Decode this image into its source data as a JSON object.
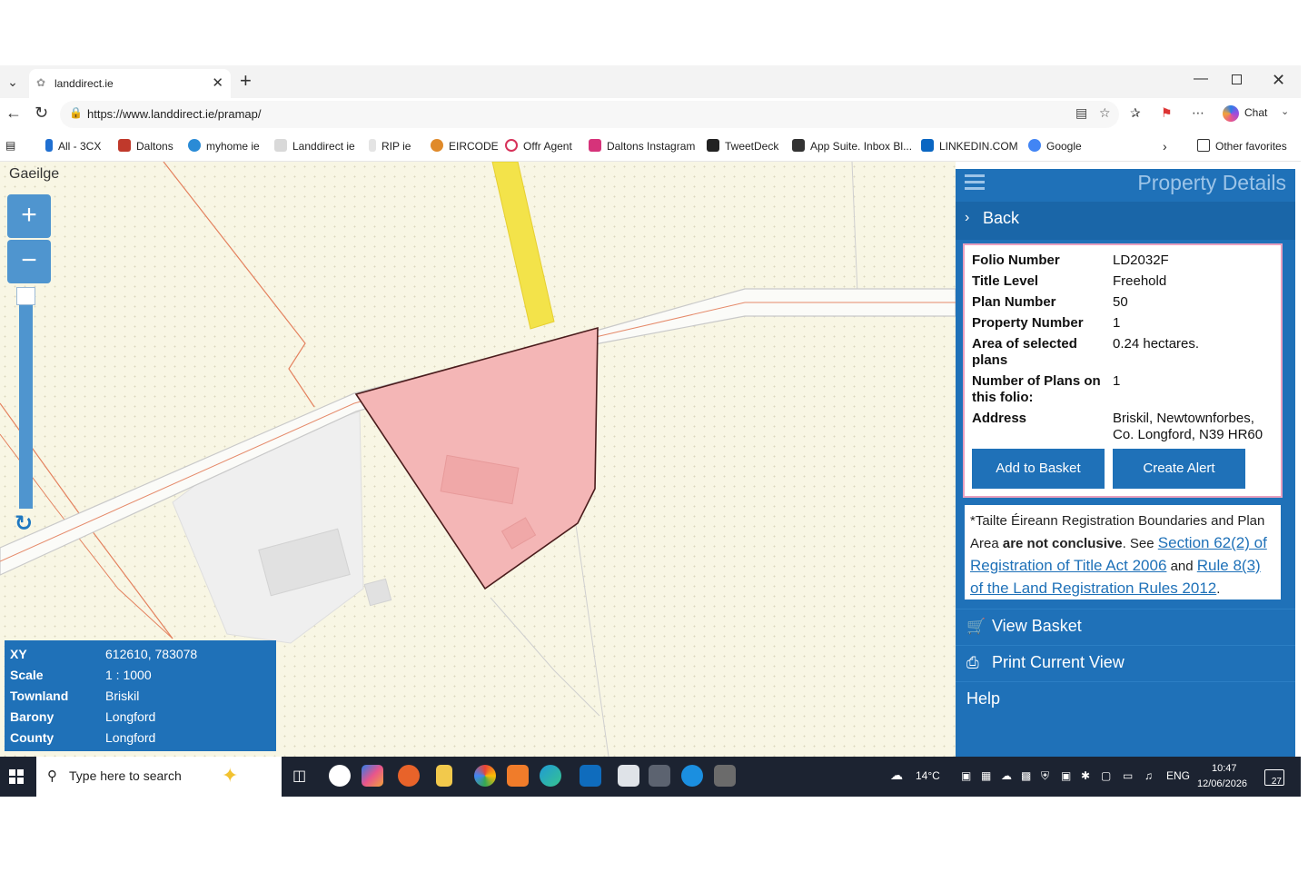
{
  "browser": {
    "tab_title": "landdirect.ie",
    "url": "https://www.landdirect.ie/pramap/",
    "chat_label": "Chat",
    "favorites": [
      {
        "label": "All - 3CX",
        "color": "#1f6fd1"
      },
      {
        "label": "Daltons",
        "color": "#c0392b"
      },
      {
        "label": "myhome ie",
        "color": "#2a8bd6"
      },
      {
        "label": "Landdirect ie",
        "color": "#b0b0b0"
      },
      {
        "label": "RIP ie",
        "color": "#c9c9c9"
      },
      {
        "label": "EIRCODE",
        "color": "#e08a2a"
      },
      {
        "label": "Offr Agent",
        "color": "#d7325a"
      },
      {
        "label": "Daltons Instagram",
        "color": "#d6337a"
      },
      {
        "label": "TweetDeck",
        "color": "#222222"
      },
      {
        "label": "App Suite. Inbox Bl...",
        "color": "#333333"
      },
      {
        "label": "LINKEDIN.COM",
        "color": "#0a66c2"
      },
      {
        "label": "Google",
        "color": "#4285f4"
      }
    ],
    "other_favorites": "Other favorites"
  },
  "map": {
    "language_toggle": "Gaeilge",
    "zoom_in": "+",
    "zoom_out": "−",
    "parcel_color": "#f4b6b6",
    "road_color": "#f3e34a",
    "info": [
      {
        "key": "XY",
        "value": "612610, 783078"
      },
      {
        "key": "Scale",
        "value": "1 : 1000"
      },
      {
        "key": "Townland",
        "value": "Briskil"
      },
      {
        "key": "Barony",
        "value": "Longford"
      },
      {
        "key": "County",
        "value": "Longford"
      }
    ]
  },
  "panel": {
    "title": "Property Details",
    "back": "Back",
    "details": [
      {
        "key": "Folio Number",
        "value": "LD2032F"
      },
      {
        "key": "Title Level",
        "value": "Freehold"
      },
      {
        "key": "Plan Number",
        "value": "50"
      },
      {
        "key": "Property Number",
        "value": "1"
      },
      {
        "key": "Area of selected plans",
        "value": "0.24 hectares."
      },
      {
        "key": "Number of Plans on this folio:",
        "value": "1"
      },
      {
        "key": "Address",
        "value": "Briskil, Newtownforbes, Co. Longford, N39 HR60"
      }
    ],
    "add_to_basket": "Add to Basket",
    "create_alert": "Create Alert",
    "notice": {
      "prefix": "*Tailte Éireann Registration Boundaries and Plan Area",
      "bold": "are not conclusive",
      "see": ". See",
      "link1": "Section 62(2) of Registration of Title Act 2006",
      "and": "and",
      "link2": "Rule 8(3) of the Land Registration Rules 2012",
      "end": "."
    },
    "view_basket": "View Basket",
    "print_view": "Print Current View",
    "help": "Help",
    "accent": "#1f71b8"
  },
  "taskbar": {
    "search_placeholder": "Type here to search",
    "weather": "14°C",
    "language": "ENG",
    "time": "10:47",
    "date": "12/06/2026",
    "notifications": "27"
  }
}
